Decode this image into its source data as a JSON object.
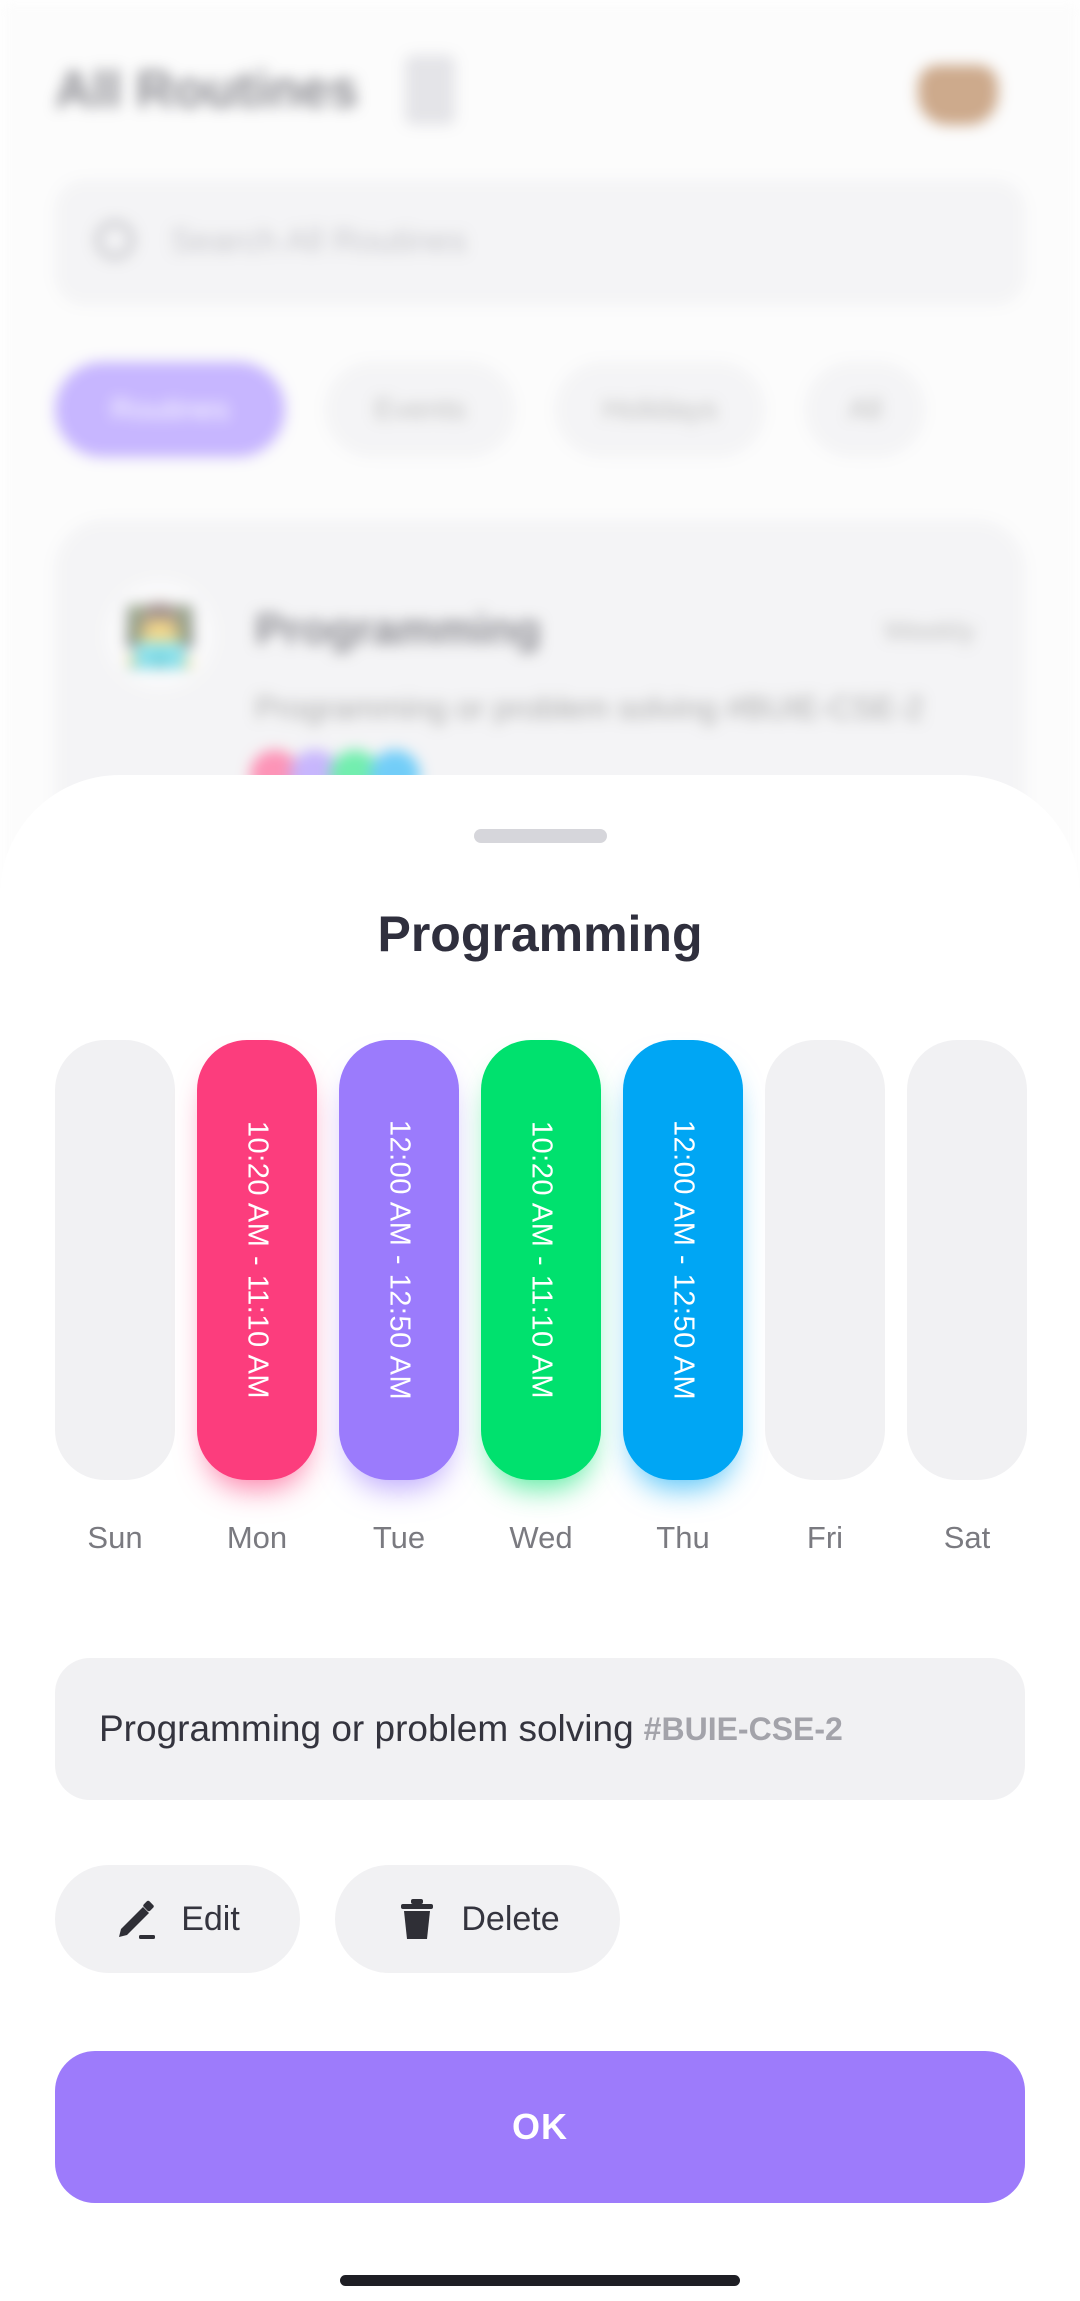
{
  "background": {
    "title": "All Routines",
    "search_placeholder": "Search All Routines",
    "chips": [
      {
        "label": "Routines",
        "active": true
      },
      {
        "label": "Events",
        "active": false
      },
      {
        "label": "Holidays",
        "active": false
      },
      {
        "label": "All",
        "active": false
      }
    ],
    "card": {
      "emoji": "👨‍💻",
      "title": "Programming",
      "badge": "Weekly",
      "description": "Programming or problem solving #BUIE-CSE-2"
    }
  },
  "sheet": {
    "title": "Programming",
    "days": [
      {
        "label": "Sun",
        "time": "",
        "color": "#f1f1f3"
      },
      {
        "label": "Mon",
        "time": "10:20 AM - 11:10 AM",
        "color": "#fc3d7d"
      },
      {
        "label": "Tue",
        "time": "12:00 AM - 12:50 AM",
        "color": "#9b7bfc"
      },
      {
        "label": "Wed",
        "time": "10:20 AM - 11:10 AM",
        "color": "#00e16e"
      },
      {
        "label": "Thu",
        "time": "12:00 AM - 12:50 AM",
        "color": "#00a6f4"
      },
      {
        "label": "Fri",
        "time": "",
        "color": "#f1f1f3"
      },
      {
        "label": "Sat",
        "time": "",
        "color": "#f1f1f3"
      }
    ],
    "description": "Programming or problem solving",
    "tag": "#BUIE-CSE-2",
    "edit_label": "Edit",
    "edit_icon": "pencil-icon",
    "delete_label": "Delete",
    "delete_icon": "trash-icon",
    "ok_label": "OK",
    "accent_color": "#9d7bfb"
  }
}
